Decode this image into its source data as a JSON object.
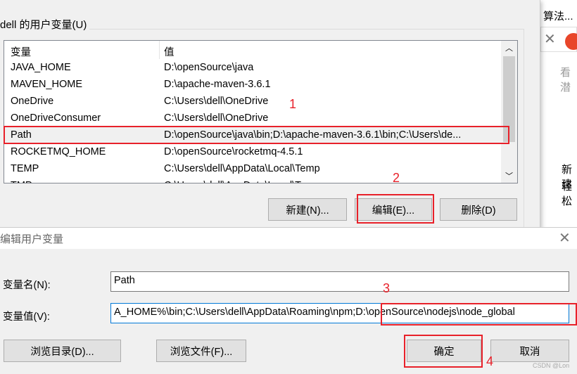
{
  "background": {
    "texts": [
      "算法...",
      "看潜",
      "新建",
      "轻松"
    ]
  },
  "user_vars": {
    "group_label": "dell 的用户变量(U)",
    "columns": [
      "变量",
      "值"
    ],
    "rows": [
      {
        "name": "JAVA_HOME",
        "value": "D:\\openSource\\java"
      },
      {
        "name": "MAVEN_HOME",
        "value": "D:\\apache-maven-3.6.1"
      },
      {
        "name": "OneDrive",
        "value": "C:\\Users\\dell\\OneDrive"
      },
      {
        "name": "OneDriveConsumer",
        "value": "C:\\Users\\dell\\OneDrive"
      },
      {
        "name": "Path",
        "value": "D:\\openSource\\java\\bin;D:\\apache-maven-3.6.1\\bin;C:\\Users\\de..."
      },
      {
        "name": "ROCKETMQ_HOME",
        "value": "D:\\openSource\\rocketmq-4.5.1"
      },
      {
        "name": "TEMP",
        "value": "C:\\Users\\dell\\AppData\\Local\\Temp"
      },
      {
        "name": "TMP",
        "value": "C:\\Users\\dell\\AppData\\Local\\Temp"
      }
    ],
    "selected": "Path",
    "buttons": {
      "new": "新建(N)...",
      "edit": "编辑(E)...",
      "delete": "删除(D)"
    }
  },
  "edit_dialog": {
    "title": "编辑用户变量",
    "name_label": "变量名(N):",
    "name_value": "Path",
    "value_label": "变量值(V):",
    "value_value": "A_HOME%\\bin;C:\\Users\\dell\\AppData\\Roaming\\npm;D:\\openSource\\nodejs\\node_global",
    "buttons": {
      "browse_dir": "浏览目录(D)...",
      "browse_file": "浏览文件(F)...",
      "ok": "确定",
      "cancel": "取消"
    }
  },
  "annotations": [
    "1",
    "2",
    "3",
    "4"
  ],
  "watermark": "CSDN @Lon",
  "colors": {
    "highlight": "#e8212a",
    "focus": "#0078d7"
  }
}
